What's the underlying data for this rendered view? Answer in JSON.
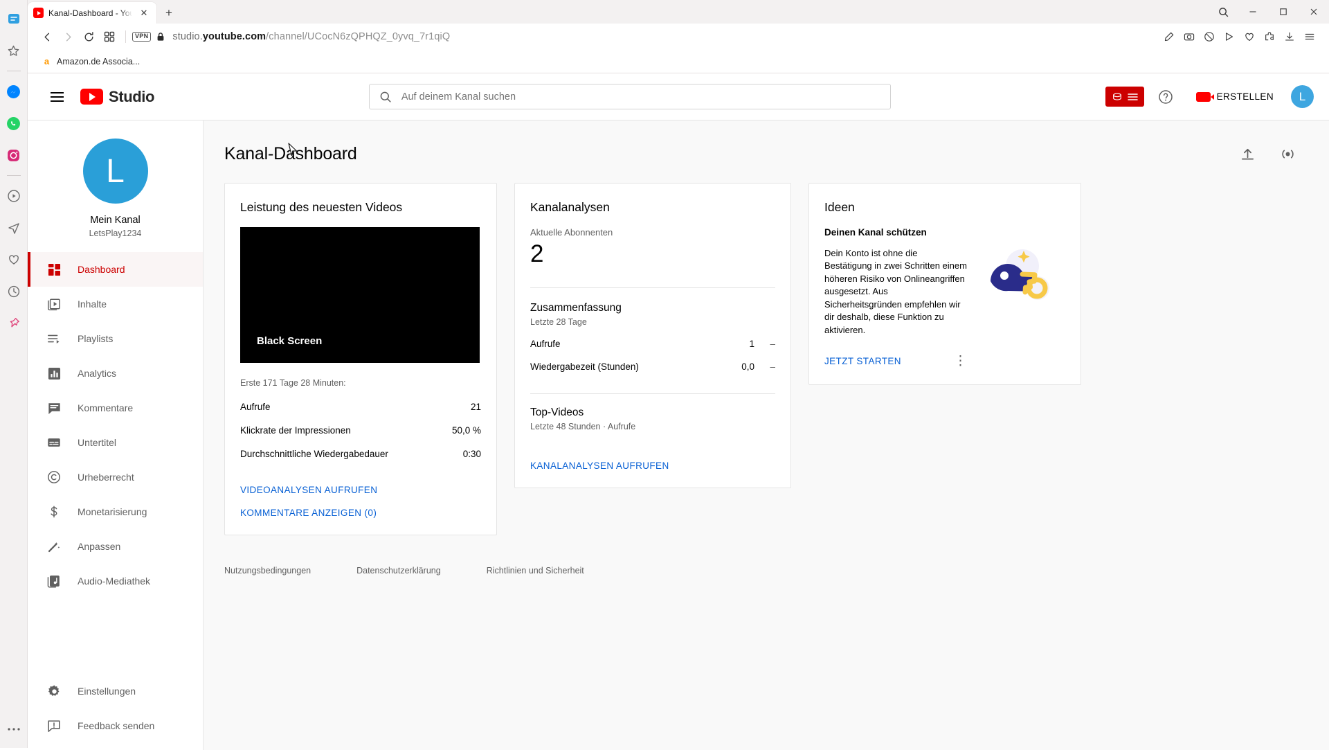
{
  "browser": {
    "name": "opera",
    "tab": {
      "title": "Kanal-Dashboard - YouTub",
      "close_label": "✕"
    },
    "new_tab_label": "+",
    "nav": {
      "back": "back-arrow",
      "forward": "forward-arrow",
      "reload": "reload",
      "tabgrid": "tab-grid"
    },
    "vpn_badge": "VPN",
    "url": {
      "scheme_host_prefix": "studio.",
      "host_bold": "youtube.com",
      "path": "/channel/UCocN6zQPHQZ_0yvq_7r1qiQ"
    },
    "bookmark": {
      "label": "Amazon.de Associa...",
      "favicon": "a"
    },
    "window_controls": {
      "minimize": "–",
      "maximize": "□",
      "close": "✕"
    }
  },
  "header": {
    "menu_label": "hamburger-menu",
    "logo_text": "Studio",
    "search_placeholder": "Auf deinem Kanal suchen",
    "create_label": "ERSTELLEN",
    "avatar_letter": "L",
    "help_label": "?"
  },
  "sidebar": {
    "channel": {
      "avatar_letter": "L",
      "name": "Mein Kanal",
      "handle": "LetsPlay1234"
    },
    "items": [
      {
        "label": "Dashboard",
        "icon": "dashboard-icon",
        "active": true
      },
      {
        "label": "Inhalte",
        "icon": "content-icon",
        "active": false
      },
      {
        "label": "Playlists",
        "icon": "playlist-icon",
        "active": false
      },
      {
        "label": "Analytics",
        "icon": "analytics-icon",
        "active": false
      },
      {
        "label": "Kommentare",
        "icon": "comment-icon",
        "active": false
      },
      {
        "label": "Untertitel",
        "icon": "subtitles-icon",
        "active": false
      },
      {
        "label": "Urheberrecht",
        "icon": "copyright-icon",
        "active": false
      },
      {
        "label": "Monetarisierung",
        "icon": "dollar-icon",
        "active": false
      },
      {
        "label": "Anpassen",
        "icon": "wand-icon",
        "active": false
      },
      {
        "label": "Audio-Mediathek",
        "icon": "audio-icon",
        "active": false
      }
    ],
    "bottom_items": [
      {
        "label": "Einstellungen",
        "icon": "gear-icon"
      },
      {
        "label": "Feedback senden",
        "icon": "feedback-icon"
      }
    ]
  },
  "page": {
    "title": "Kanal-Dashboard",
    "actions": [
      {
        "name": "upload-video",
        "icon": "upload-icon"
      },
      {
        "name": "go-live",
        "icon": "live-icon"
      }
    ]
  },
  "card_video": {
    "title": "Leistung des neuesten Videos",
    "thumbnail_label": "Black Screen",
    "period": "Erste 171 Tage 28 Minuten:",
    "stats": [
      {
        "label": "Aufrufe",
        "value": "21"
      },
      {
        "label": "Klickrate der Impressionen",
        "value": "50,0 %"
      },
      {
        "label": "Durchschnittliche Wiedergabedauer",
        "value": "0:30"
      }
    ],
    "link_analytics": "VIDEOANALYSEN AUFRUFEN",
    "link_comments": "KOMMENTARE ANZEIGEN (0)"
  },
  "card_analytics": {
    "title": "Kanalanalysen",
    "subs_label": "Aktuelle Abonnenten",
    "subs_count": "2",
    "summary_title": "Zusammenfassung",
    "summary_period": "Letzte 28 Tage",
    "summary_rows": [
      {
        "label": "Aufrufe",
        "value": "1",
        "delta": "–"
      },
      {
        "label": "Wiedergabezeit (Stunden)",
        "value": "0,0",
        "delta": "–"
      }
    ],
    "top_title": "Top-Videos",
    "top_sub": "Letzte 48 Stunden · Aufrufe",
    "link": "KANALANALYSEN AUFRUFEN"
  },
  "card_ideas": {
    "title": "Ideen",
    "headline": "Deinen Kanal schützen",
    "body": "Dein Konto ist ohne die Bestätigung in zwei Schritten einem höheren Risiko von Onlineangriffen ausgesetzt. Aus Sicherheitsgründen empfehlen wir dir deshalb, diese Funktion zu aktivieren.",
    "cta": "JETZT STARTEN",
    "more_label": "⋮",
    "art_name": "security-key-illustration"
  },
  "footer": {
    "links": [
      "Nutzungsbedingungen",
      "Datenschutzerklärung",
      "Richtlinien und Sicherheit"
    ]
  },
  "colors": {
    "brand_red": "#cc0000",
    "link_blue": "#065fd4",
    "avatar_blue": "#2a9fd8",
    "page_bg": "#f9f9f9"
  }
}
